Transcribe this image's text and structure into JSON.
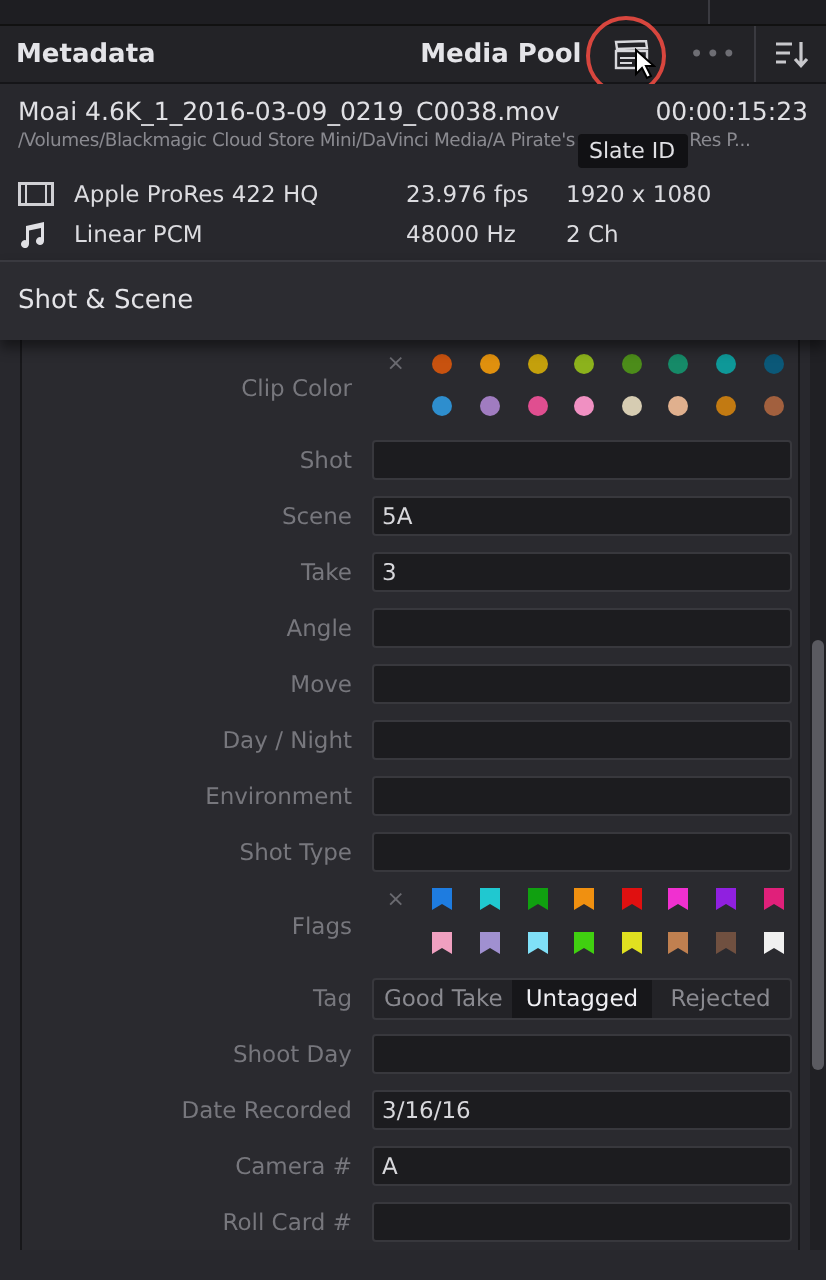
{
  "header": {
    "title": "Metadata",
    "pool_label": "Media Pool",
    "menu": "•••",
    "tooltip": "Slate ID"
  },
  "clip": {
    "name": "Moai 4.6K_1_2016-03-09_0219_C0038.mov",
    "duration": "00:00:15:23",
    "path": "/Volumes/Blackmagic Cloud Store Mini/DaVinci Media/A Pirate's",
    "path_tail": "Res P...",
    "streams": [
      {
        "kind": "video",
        "codec": "Apple ProRes 422 HQ",
        "rate": "23.976 fps",
        "format": "1920 x 1080"
      },
      {
        "kind": "audio",
        "codec": "Linear PCM",
        "rate": "48000 Hz",
        "format": "2 Ch"
      }
    ]
  },
  "section": {
    "title": "Shot & Scene"
  },
  "rows": [
    {
      "kind": "colors",
      "label": "Clip Color",
      "clear": "×",
      "colors": [
        {
          "color": "#c8520f"
        },
        {
          "color": "#e0900e"
        },
        {
          "color": "#c4a00c"
        },
        {
          "color": "#8cb21c"
        },
        {
          "color": "#4c8c1a"
        },
        {
          "color": "#168a68"
        },
        {
          "color": "#0e9898"
        },
        {
          "color": "#0b5878"
        },
        {
          "color": "#2e8ece"
        },
        {
          "color": "#a07cc0"
        },
        {
          "color": "#e04e90"
        },
        {
          "color": "#f090c2"
        },
        {
          "color": "#d6ccb2"
        },
        {
          "color": "#e0b08e"
        },
        {
          "color": "#c27a12"
        },
        {
          "color": "#a2603e"
        }
      ]
    },
    {
      "kind": "text",
      "label": "Shot"
    },
    {
      "kind": "text",
      "label": "Scene",
      "value": "5A"
    },
    {
      "kind": "text",
      "label": "Take",
      "value": "3"
    },
    {
      "kind": "text",
      "label": "Angle"
    },
    {
      "kind": "text",
      "label": "Move"
    },
    {
      "kind": "text",
      "label": "Day / Night"
    },
    {
      "kind": "text",
      "label": "Environment"
    },
    {
      "kind": "text",
      "label": "Shot Type"
    },
    {
      "kind": "flags",
      "label": "Flags",
      "clear": "×",
      "colors": [
        {
          "color": "#1e7ce0"
        },
        {
          "color": "#20c8d0"
        },
        {
          "color": "#10a010"
        },
        {
          "color": "#f09010"
        },
        {
          "color": "#e01010"
        },
        {
          "color": "#f030d0"
        },
        {
          "color": "#9020e0"
        },
        {
          "color": "#e0207a"
        },
        {
          "color": "#f0a0c0"
        },
        {
          "color": "#a090d0"
        },
        {
          "color": "#80e0f8"
        },
        {
          "color": "#40d010"
        },
        {
          "color": "#e0e020"
        },
        {
          "color": "#c08050"
        },
        {
          "color": "#705040"
        },
        {
          "color": "#f0f0f0"
        }
      ]
    },
    {
      "kind": "tag",
      "label": "Tag",
      "options": [
        {
          "label": "Good Take",
          "selected": false
        },
        {
          "label": "Untagged",
          "selected": true
        },
        {
          "label": "Rejected",
          "selected": false
        }
      ]
    },
    {
      "kind": "text",
      "label": "Shoot Day"
    },
    {
      "kind": "text",
      "label": "Date Recorded",
      "value": "3/16/16"
    },
    {
      "kind": "text",
      "label": "Camera #",
      "value": "A"
    },
    {
      "kind": "text",
      "label": "Roll Card #"
    }
  ]
}
